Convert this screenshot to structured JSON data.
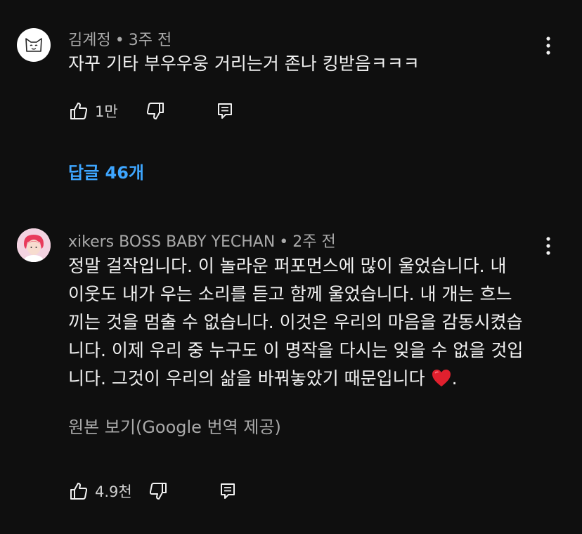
{
  "comments": [
    {
      "author": "김계정",
      "time": "3주 전",
      "text_lines": [
        "자꾸 기타 부우우웅 거리는거 존나 킹받음ㅋㅋㅋ"
      ],
      "likes": "1만",
      "replies_label": "답글 46개"
    },
    {
      "author": "xikers BOSS BABY YECHAN",
      "time": "2주 전",
      "text_lines": [
        "정말 걸작입니다. 이 놀라운 퍼포먼스에 많이 울었습니다. 내",
        "이웃도 내가 우는 소리를 듣고 함께 울었습니다. 내 개는 흐느",
        "끼는 것을 멈출 수 없습니다. 이것은 우리의 마음을 감동시켰습",
        "니다. 이제 우리 중 누구도 이 명작을 다시는 잊을 수 없을 것입",
        "니다. 그것이 우리의 삶을 바꿔놓았기 때문입니다"
      ],
      "text_tail": ".",
      "translation_label": "원본 보기(Google 번역 제공)",
      "likes": "4.9천"
    }
  ],
  "separator": "•",
  "colors": {
    "background": "#0f0f0f",
    "text": "#f1f1f1",
    "secondary": "#aaaaaa",
    "link": "#3ea6ff",
    "heart": "#e0202e"
  },
  "icons": [
    "cat-avatar",
    "more-vert-icon",
    "thumb-up-icon",
    "thumb-down-icon",
    "reply-icon",
    "heart-emoji"
  ]
}
